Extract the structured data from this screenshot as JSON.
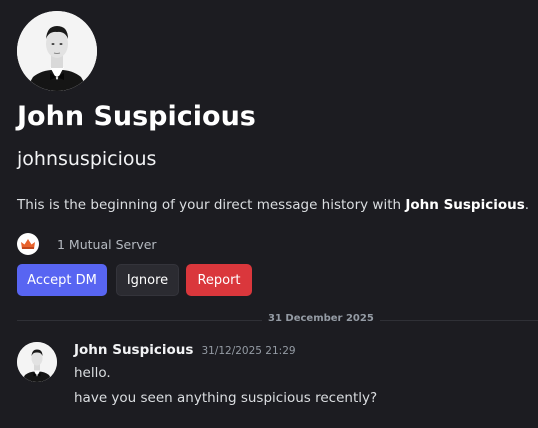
{
  "profile": {
    "display_name": "John Suspicious",
    "username": "johnsuspicious",
    "intro_prefix": "This is the beginning of your direct message history with ",
    "intro_name": "John Suspicious",
    "intro_suffix": ".",
    "mutual_servers": "1 Mutual Server"
  },
  "actions": {
    "accept_label": "Accept DM",
    "ignore_label": "Ignore",
    "report_label": "Report"
  },
  "divider": {
    "date": "31 December 2025"
  },
  "messages": [
    {
      "author": "John Suspicious",
      "timestamp": "31/12/2025 21:29",
      "lines": [
        "hello.",
        "have you seen anything suspicious recently?"
      ]
    }
  ],
  "colors": {
    "background": "#1c1c21",
    "accept": "#5865f2",
    "ignore": "#2b2b31",
    "report": "#da373c"
  },
  "icons": {
    "server": "crown-server-icon",
    "avatar": "man-in-tuxedo-avatar"
  }
}
